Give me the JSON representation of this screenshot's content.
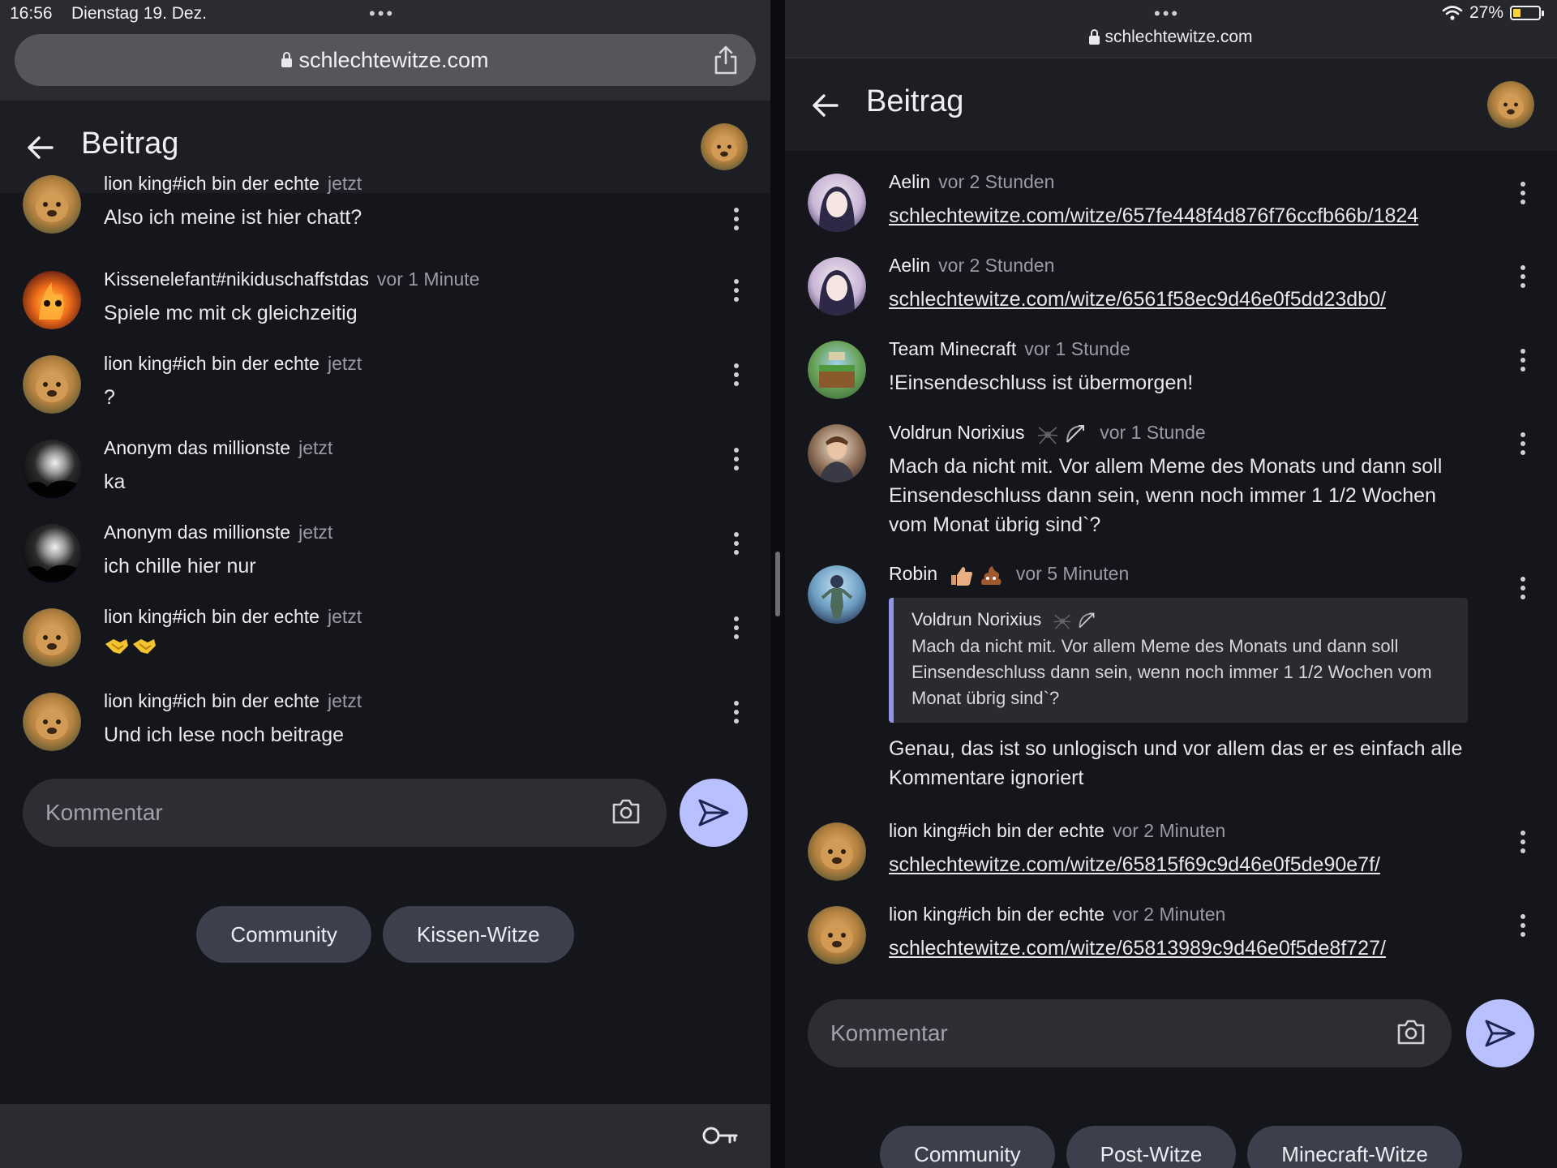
{
  "status": {
    "time": "16:56",
    "date": "Dienstag 19. Dez.",
    "battery_label": "27%",
    "battery_level": 0.27
  },
  "colors": {
    "background": "#15161c",
    "appbar": "#1d1e24",
    "accent": "#b9c0ff",
    "chip": "#3d3f4c",
    "quote_border": "#8f96e6"
  },
  "left": {
    "url": "schlechtewitze.com",
    "title": "Beitrag",
    "comments": [
      {
        "author": "lion king#ich bin der echte",
        "time": "jetzt",
        "text": "Also ich meine ist hier chatt?",
        "avatar": "lion-avatar"
      },
      {
        "author": "Kissenelefant#nikiduschaffstdas",
        "time": "vor 1 Minute",
        "text": "Spiele mc mit ck gleichzeitig",
        "avatar": "fire-avatar"
      },
      {
        "author": "lion king#ich bin der echte",
        "time": "jetzt",
        "text": "?",
        "avatar": "lion-avatar"
      },
      {
        "author": "Anonym das millionste",
        "time": "jetzt",
        "text": "ka",
        "avatar": "moon-avatar"
      },
      {
        "author": "Anonym das millionste",
        "time": "jetzt",
        "text": "ich chille hier nur",
        "avatar": "moon-avatar"
      },
      {
        "author": "lion king#ich bin der echte",
        "time": "jetzt",
        "text": "",
        "emoji": "handshake-emoji",
        "avatar": "lion-avatar"
      },
      {
        "author": "lion king#ich bin der echte",
        "time": "jetzt",
        "text": "Und ich lese noch beitrage",
        "avatar": "lion-avatar"
      }
    ],
    "input_placeholder": "Kommentar",
    "chips": [
      "Community",
      "Kissen-Witze"
    ]
  },
  "right": {
    "url": "schlechtewitze.com",
    "title": "Beitrag",
    "comments": [
      {
        "author": "Aelin",
        "time": "vor 2 Stunden",
        "link": "schlechtewitze.com/witze/657fe448f4d876f76ccfb66b/1824"
      },
      {
        "author": "Aelin",
        "time": "vor 2 Stunden",
        "link": "schlechtewitze.com/witze/6561f58ec9d46e0f5dd23db0/"
      },
      {
        "author": "Team Minecraft",
        "time": "vor 1 Stunde",
        "text": "!Einsendeschluss ist übermorgen!"
      },
      {
        "author": "Voldrun Norixius",
        "time": "vor 1 Stunde",
        "text": "Mach da nicht mit. Vor allem Meme des Monats und dann soll Einsendeschluss dann sein, wenn noch immer 1 1/2 Wochen vom Monat übrig sind`?"
      },
      {
        "author": "Robin",
        "time": "vor 5 Minuten",
        "quote": {
          "author": "Voldrun Norixius",
          "text": "Mach da nicht mit. Vor allem Meme des Monats und dann soll Einsendeschluss dann sein, wenn noch immer 1 1/2 Wochen vom Monat übrig sind`?"
        },
        "text": "Genau, das ist so unlogisch und vor allem das er es einfach alle Kommentare ignoriert"
      },
      {
        "author": "lion king#ich bin der echte",
        "time": "vor 2 Minuten",
        "link": "schlechtewitze.com/witze/65815f69c9d46e0f5de90e7f/"
      },
      {
        "author": "lion king#ich bin der echte",
        "time": "vor 2 Minuten",
        "link": "schlechtewitze.com/witze/65813989c9d46e0f5de8f727/"
      }
    ],
    "input_placeholder": "Kommentar",
    "chips": [
      "Community",
      "Post-Witze",
      "Minecraft-Witze"
    ]
  }
}
